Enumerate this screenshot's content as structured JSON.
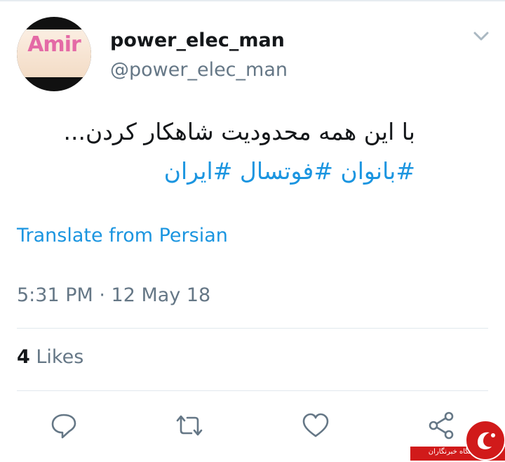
{
  "tweet": {
    "display_name": "power_elec_man",
    "handle": "@power_elec_man",
    "text_line1": "با این همه محدودیت شاهکار کردن...",
    "hashtags": "#بانوان #فوتسال #ایران",
    "translate_label": "Translate from Persian",
    "timestamp": "5:31 PM · 12 May 18",
    "likes_count": "4",
    "likes_label": "Likes",
    "avatar_text": "Amir"
  },
  "actions": [
    "reply-icon",
    "retweet-icon",
    "like-icon",
    "share-icon"
  ],
  "watermark": {
    "text": "باشگاه خبرنگاران"
  },
  "colors": {
    "link": "#1b95e0",
    "secondary_text": "#657786",
    "primary_text": "#14171a",
    "divider": "#e1e8ed"
  }
}
